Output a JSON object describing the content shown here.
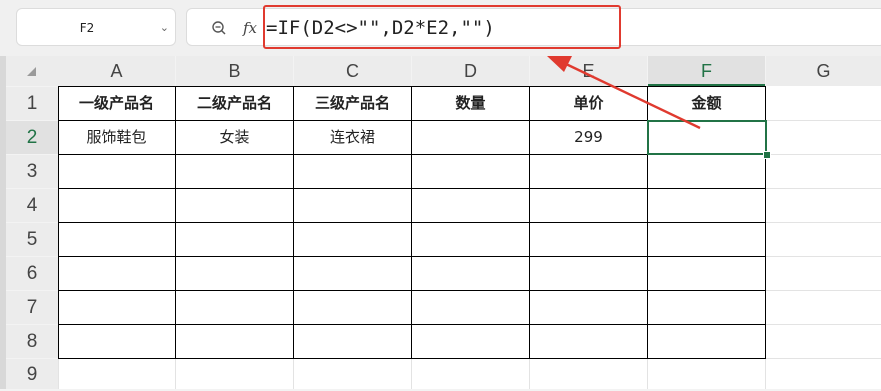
{
  "name_box": {
    "value": "F2"
  },
  "formula_bar": {
    "fx_label": "fx",
    "formula": "=IF(D2<>\"\",D2*E2,\"\")"
  },
  "columns": [
    "A",
    "B",
    "C",
    "D",
    "E",
    "F",
    "G"
  ],
  "active_column": "F",
  "rows": [
    "1",
    "2",
    "3",
    "4",
    "5",
    "6",
    "7",
    "8",
    "9"
  ],
  "active_row": "2",
  "table": {
    "headers": [
      "一级产品名",
      "二级产品名",
      "三级产品名",
      "数量",
      "单价",
      "金额"
    ],
    "row2": [
      "服饰鞋包",
      "女装",
      "连衣裙",
      "",
      "299",
      ""
    ]
  },
  "annotation_color": "#e03a2f",
  "selection_color": "#217346"
}
